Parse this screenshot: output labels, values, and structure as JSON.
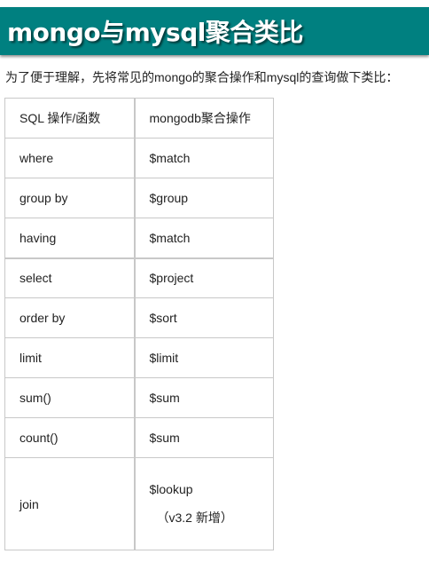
{
  "title": "mongo与mysql聚合类比",
  "intro": "为了便于理解，先将常见的mongo的聚合操作和mysql的查询做下类比：",
  "table": {
    "header": [
      "SQL 操作/函数",
      "mongodb聚合操作"
    ],
    "rows": [
      {
        "sql": "where",
        "mongo": "$match"
      },
      {
        "sql": "group by",
        "mongo": "$group"
      },
      {
        "sql": "having",
        "mongo": "$match"
      },
      {
        "sql": "select",
        "mongo": "$project"
      },
      {
        "sql": "order by",
        "mongo": "$sort"
      },
      {
        "sql": "limit",
        "mongo": "$limit"
      },
      {
        "sql": "sum()",
        "mongo": "$sum"
      },
      {
        "sql": "count()",
        "mongo": "$sum"
      },
      {
        "sql": "join",
        "mongo": "$lookup",
        "note": "（v3.2 新增）"
      }
    ]
  },
  "colors": {
    "title_bg": "#008080",
    "title_text": "#ffffff",
    "border": "#c8c8c8"
  }
}
